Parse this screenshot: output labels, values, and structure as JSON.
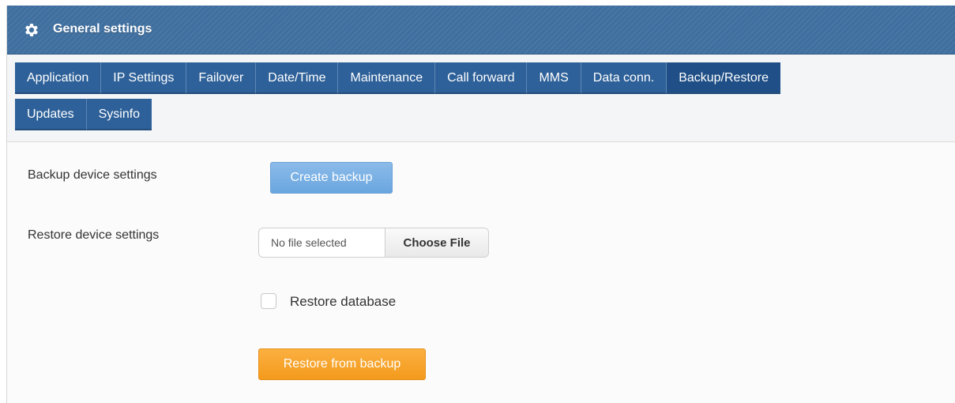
{
  "header": {
    "title": "General settings",
    "icon": "gear-icon"
  },
  "tabs": {
    "row1": [
      "Application",
      "IP Settings",
      "Failover",
      "Date/Time",
      "Maintenance",
      "Call forward",
      "MMS",
      "Data conn.",
      "Backup/Restore"
    ],
    "row2": [
      "Updates",
      "Sysinfo"
    ],
    "active": "Backup/Restore"
  },
  "backup": {
    "label": "Backup device settings",
    "button": "Create backup"
  },
  "restore": {
    "label": "Restore device settings",
    "file_placeholder": "No file selected",
    "choose_button": "Choose File",
    "checkbox_label": "Restore database",
    "checkbox_checked": false,
    "button": "Restore from backup"
  },
  "colors": {
    "header": "#3f6f9f",
    "tab": "#2e6199",
    "primary_button": "#6aa6df",
    "restore_button": "#f39a1c"
  }
}
